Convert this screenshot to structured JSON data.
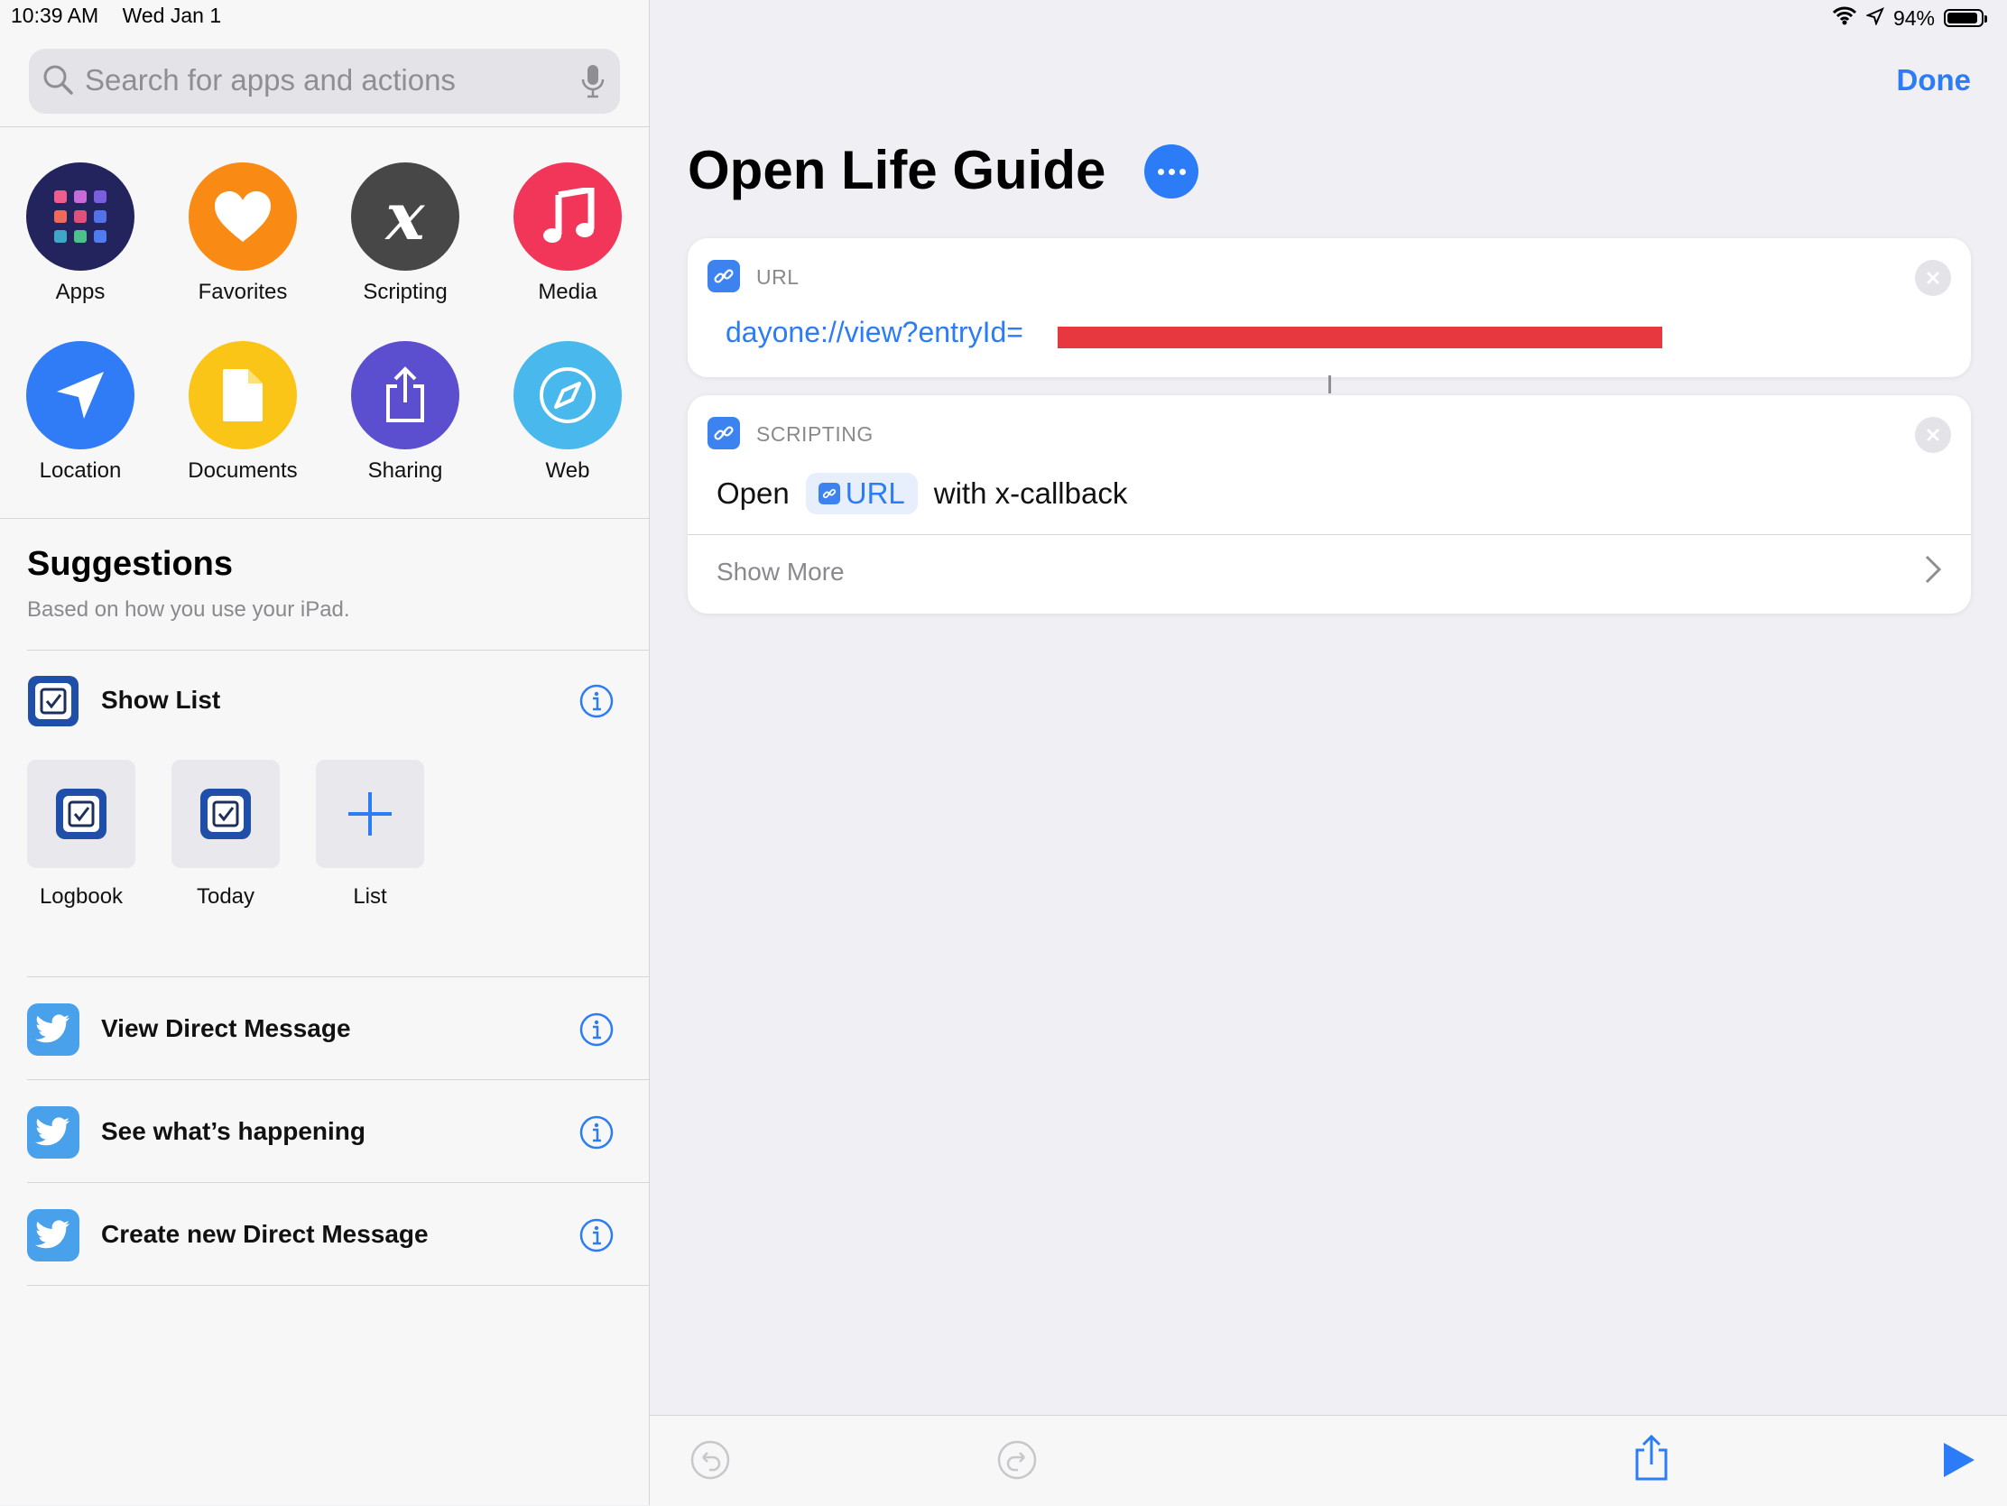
{
  "status": {
    "time": "10:39 AM",
    "date": "Wed Jan 1",
    "battery": "94%"
  },
  "search": {
    "placeholder": "Search for apps and actions"
  },
  "categories": [
    {
      "label": "Apps",
      "color": "#23235e"
    },
    {
      "label": "Favorites",
      "color": "#f98b14"
    },
    {
      "label": "Scripting",
      "color": "#474747"
    },
    {
      "label": "Media",
      "color": "#f2365a"
    },
    {
      "label": "Location",
      "color": "#2f7cf6"
    },
    {
      "label": "Documents",
      "color": "#fbc517"
    },
    {
      "label": "Sharing",
      "color": "#5b4fcf"
    },
    {
      "label": "Web",
      "color": "#49b8ec"
    }
  ],
  "suggestions": {
    "title": "Suggestions",
    "subtitle": "Based on how you use your iPad.",
    "show_list": {
      "label": "Show List"
    },
    "tiles": [
      {
        "label": "Logbook",
        "icon": "things-check-icon"
      },
      {
        "label": "Today",
        "icon": "things-check-icon"
      },
      {
        "label": "List",
        "icon": "plus-icon"
      }
    ],
    "twitter_items": [
      {
        "label": "View Direct Message"
      },
      {
        "label": "See what’s happening"
      },
      {
        "label": "Create new Direct Message"
      }
    ]
  },
  "editor": {
    "done_label": "Done",
    "title": "Open Life Guide",
    "url_card": {
      "category": "URL",
      "value": "dayone://view?entryId="
    },
    "scripting_card": {
      "category": "SCRIPTING",
      "open_word": "Open",
      "token": "URL",
      "suffix": "with x-callback",
      "show_more": "Show More"
    }
  },
  "colors": {
    "accent": "#2b7cf6",
    "redaction": "#e8383f"
  }
}
